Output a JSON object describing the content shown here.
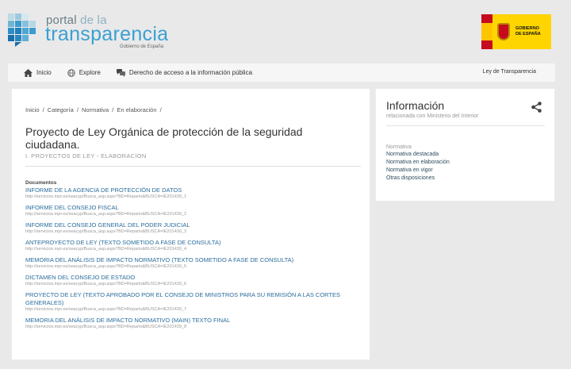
{
  "brand": {
    "line1_a": "portal ",
    "line1_b": "de la",
    "line2": "transparencia",
    "line3": "Gobierno de España",
    "gov_text_1": "GOBIERNO",
    "gov_text_2": "DE ESPAÑA"
  },
  "nav": {
    "items": [
      {
        "label": "Inicio",
        "icon": "home-icon"
      },
      {
        "label": "Explore",
        "icon": "globe-icon"
      },
      {
        "label": "Derecho de acceso a la información pública",
        "icon": "chat-icon"
      }
    ],
    "right_link": "Ley de Transparencia"
  },
  "breadcrumb": [
    "Inicio",
    "/",
    "Categoría",
    "/",
    "Normativa",
    "/",
    "En elaboración",
    "/"
  ],
  "main": {
    "title": "Proyecto de Ley Orgánica de protección de la seguridad ciudadana.",
    "subtitle": "I. PROYECTOS DE LEY - ELABORACION",
    "docs_label": "Documentos",
    "documents": [
      {
        "title": "INFORME DE LA AGENCIA DE PROTECCIÓN DE DATOS",
        "url": "http://servicios.mpr.es/seacyp/Busca_asp.aspx?BD=Reparto&BUSCA=IE201439_1"
      },
      {
        "title": "INFORME DEL CONSEJO FISCAL",
        "url": "http://servicios.mpr.es/seacyp/Busca_asp.aspx?BD=Reparto&BUSCA=IE201439_2"
      },
      {
        "title": "INFORME DEL CONSEJO GENERAL DEL PODER JUDICIAL",
        "url": "http://servicios.mpr.es/seacyp/Busca_asp.aspx?BD=Reparto&BUSCA=IE201439_3"
      },
      {
        "title": "ANTEPROYECTO DE LEY (TEXTO SOMETIDO A FASE DE CONSULTA)",
        "url": "http://servicios.mpr.es/seacyp/Busca_asp.aspx?BD=Reparto&BUSCA=IE201439_4"
      },
      {
        "title": "MEMORIA DEL ANÁLISIS DE IMPACTO NORMATIVO (TEXTO SOMETIDO A FASE DE CONSULTA)",
        "url": "http://servicios.mpr.es/seacyp/Busca_asp.aspx?BD=Reparto&BUSCA=IE201439_5"
      },
      {
        "title": "DICTAMEN DEL CONSEJO DE ESTADO",
        "url": "http://servicios.mpr.es/seacyp/Busca_asp.aspx?BD=Reparto&BUSCA=IE201439_6"
      },
      {
        "title": "PROYECTO DE LEY (TEXTO APROBADO POR EL CONSEJO DE MINISTROS PARA SU REMISIÓN A LAS CORTES GENERALES)",
        "url": "http://servicios.mpr.es/seacyp/Busca_asp.aspx?BD=Reparto&BUSCA=IE201439_7"
      },
      {
        "title": "MEMORIA DEL ANÁLISIS DE IMPACTO NORMATIVO (MAIN) TEXTO FINAL",
        "url": "http://servicios.mpr.es/seacyp/Busca_asp.aspx?BD=Reparto&BUSCA=IE201439_8"
      }
    ]
  },
  "side": {
    "title": "Información",
    "subtitle": "relacionada con Ministerio del Interior",
    "list_head": "Normativa",
    "links": [
      "Normativa destacada",
      "Normativa en elaboración",
      "Normativa en vigor",
      "Otras disposiciones"
    ]
  },
  "colors": {
    "accent": "#3aa0d3",
    "link": "#2a6d9c",
    "background": "#e9e9e9"
  }
}
